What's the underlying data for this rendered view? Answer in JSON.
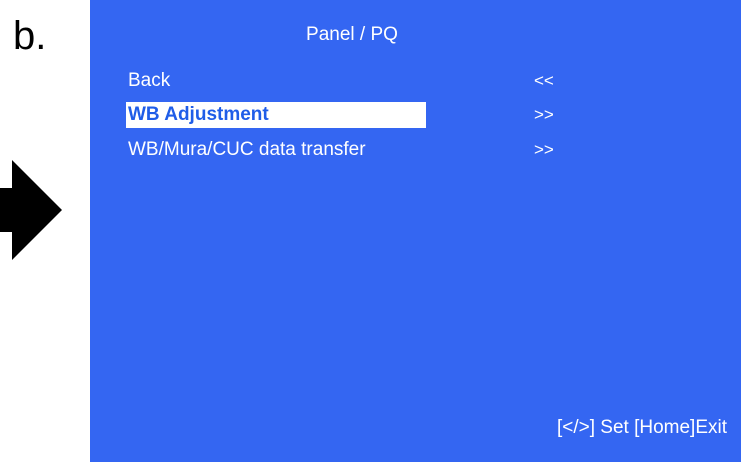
{
  "step_label": "b.",
  "osd": {
    "title": "Panel / PQ",
    "menu": [
      {
        "label": "Back",
        "nav": "<<",
        "selected": false
      },
      {
        "label": "WB Adjustment",
        "nav": ">>",
        "selected": true
      },
      {
        "label": "WB/Mura/CUC data transfer",
        "nav": ">>",
        "selected": false
      }
    ],
    "footer": "[</>] Set [Home]Exit"
  },
  "colors": {
    "osd_background": "#3466f2",
    "selected_text": "#1f5de8",
    "arrow": "#000000"
  },
  "icons": {
    "pointer": "right-arrow-icon"
  }
}
